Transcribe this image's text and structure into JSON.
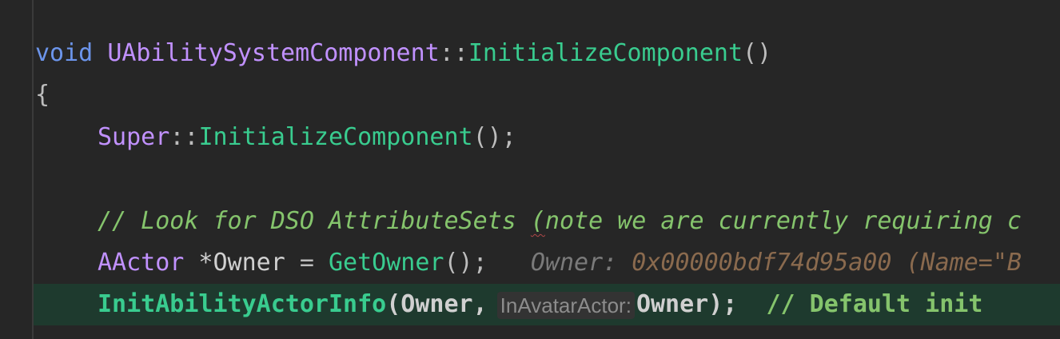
{
  "code": {
    "line1": {
      "kw_void": "void",
      "class_name": "UAbilitySystemComponent",
      "scope_op": "::",
      "method_name": "InitializeComponent",
      "parens": "()"
    },
    "line2": {
      "brace": "{"
    },
    "line3": {
      "super": "Super",
      "scope_op": "::",
      "method_name": "InitializeComponent",
      "call_end": "();"
    },
    "line4": {
      "comment_before": "// Look for DSO AttributeSets ",
      "comment_squiggle": "(",
      "comment_after": "note we are currently requiring c"
    },
    "line5": {
      "type": "AActor",
      "star_owner": " *Owner",
      "assign": " = ",
      "fn": "GetOwner",
      "call_end": "();",
      "debug_name": "Owner:",
      "debug_value": " 0x00000bdf74d95a00 (Name=\"B"
    },
    "line6": {
      "fn": "InitAbilityActorInfo",
      "args_start": "(Owner,",
      "hint": "InAvatarActor:",
      "args_end": "Owner);",
      "comment": "// Default init"
    }
  },
  "colors": {
    "background": "#262626",
    "current_line": "#1e3a2e",
    "keyword": "#6c95eb",
    "type": "#c191ff",
    "function": "#39cc8f",
    "comment": "#85c46c"
  }
}
